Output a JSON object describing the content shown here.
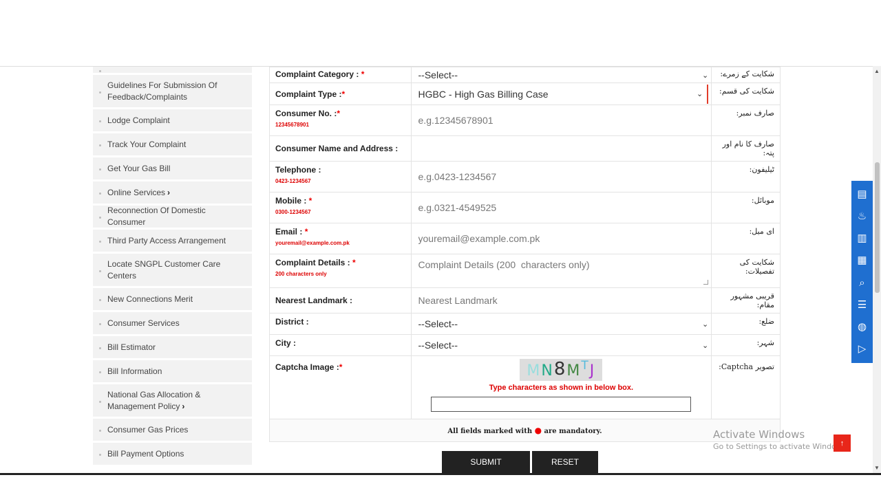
{
  "sidebar": {
    "items": [
      {
        "label": "Guidelines For Submission Of Feedback/Complaints",
        "arrow": ""
      },
      {
        "label": "Lodge Complaint",
        "arrow": ""
      },
      {
        "label": "Track Your Complaint",
        "arrow": ""
      },
      {
        "label": "Get Your Gas Bill",
        "arrow": ""
      },
      {
        "label": "Online Services",
        "arrow": "›"
      },
      {
        "label": "Reconnection Of Domestic Consumer",
        "arrow": ""
      },
      {
        "label": "Third Party Access Arrangement",
        "arrow": ""
      },
      {
        "label": "Locate SNGPL Customer Care Centers",
        "arrow": ""
      },
      {
        "label": "New Connections Merit",
        "arrow": ""
      },
      {
        "label": "Consumer Services",
        "arrow": ""
      },
      {
        "label": "Bill Estimator",
        "arrow": ""
      },
      {
        "label": "Bill Information",
        "arrow": ""
      },
      {
        "label": "National Gas Allocation & Management Policy",
        "arrow": "›"
      },
      {
        "label": "Consumer Gas Prices",
        "arrow": ""
      },
      {
        "label": "Bill Payment Options",
        "arrow": ""
      }
    ]
  },
  "form": {
    "complaint_category": {
      "label": "Complaint Category : ",
      "req": "*",
      "value": "--Select--",
      "urdu": "شکایت کے زمرے:"
    },
    "complaint_type": {
      "label": "Complaint Type :",
      "req": "*",
      "value": "HGBC - High Gas Billing Case",
      "urdu": "شکایت کی قسم:"
    },
    "consumer_no": {
      "label": "Consumer No. :",
      "req": "*",
      "hint": "12345678901",
      "placeholder": "e.g.12345678901",
      "urdu": "صارف نمبر:"
    },
    "consumer_name": {
      "label": "Consumer Name and Address :",
      "urdu": "صارف کا نام اور پتہ:"
    },
    "telephone": {
      "label": "Telephone :",
      "hint": "0423-1234567",
      "placeholder": "e.g.0423-1234567",
      "urdu": "ٹیلیفون:"
    },
    "mobile": {
      "label": "Mobile : ",
      "req": "*",
      "hint": "0300-1234567",
      "placeholder": "e.g.0321-4549525",
      "urdu": "موبائل:"
    },
    "email": {
      "label": "Email : ",
      "req": "*",
      "hint": "youremail@example.com.pk",
      "placeholder": "youremail@example.com.pk",
      "urdu": "ای میل:"
    },
    "complaint_details": {
      "label": "Complaint Details : ",
      "req": "*",
      "hint": "200 characters only",
      "placeholder": "Complaint Details (200  characters only)",
      "urdu": "شکایت کی تفصیلات:"
    },
    "landmark": {
      "label": "Nearest Landmark :",
      "placeholder": "Nearest Landmark",
      "urdu": "قریبی مشہور مقام:"
    },
    "district": {
      "label": "District :",
      "value": "--Select--",
      "urdu": "ضلع:"
    },
    "city": {
      "label": "City :",
      "value": "--Select--",
      "urdu": "شہر:"
    },
    "captcha": {
      "label": "Captcha Image :",
      "req": "*",
      "chars": [
        "M",
        "N",
        "8",
        "M",
        "T",
        "J"
      ],
      "note": "Type characters as shown in below box.",
      "urdu": "تصویر Captcha:"
    },
    "footer_note_pre": "All fields marked with ",
    "footer_note_dot": "●",
    "footer_note_post": " are mandatory."
  },
  "buttons": {
    "submit": "SUBMIT",
    "reset": "RESET"
  },
  "watermark": {
    "title": "Activate Windows",
    "subtitle": "Go to Settings to activate Windows."
  },
  "colors": {
    "accent_red": "#e23c2a",
    "float_bar": "#1f6fd0",
    "button_dark": "#222222"
  },
  "float_icons": [
    "bill-icon",
    "gas-flame-icon",
    "document-icon",
    "calculator-icon",
    "search-doc-icon",
    "list-icon",
    "globe-icon",
    "send-icon"
  ]
}
